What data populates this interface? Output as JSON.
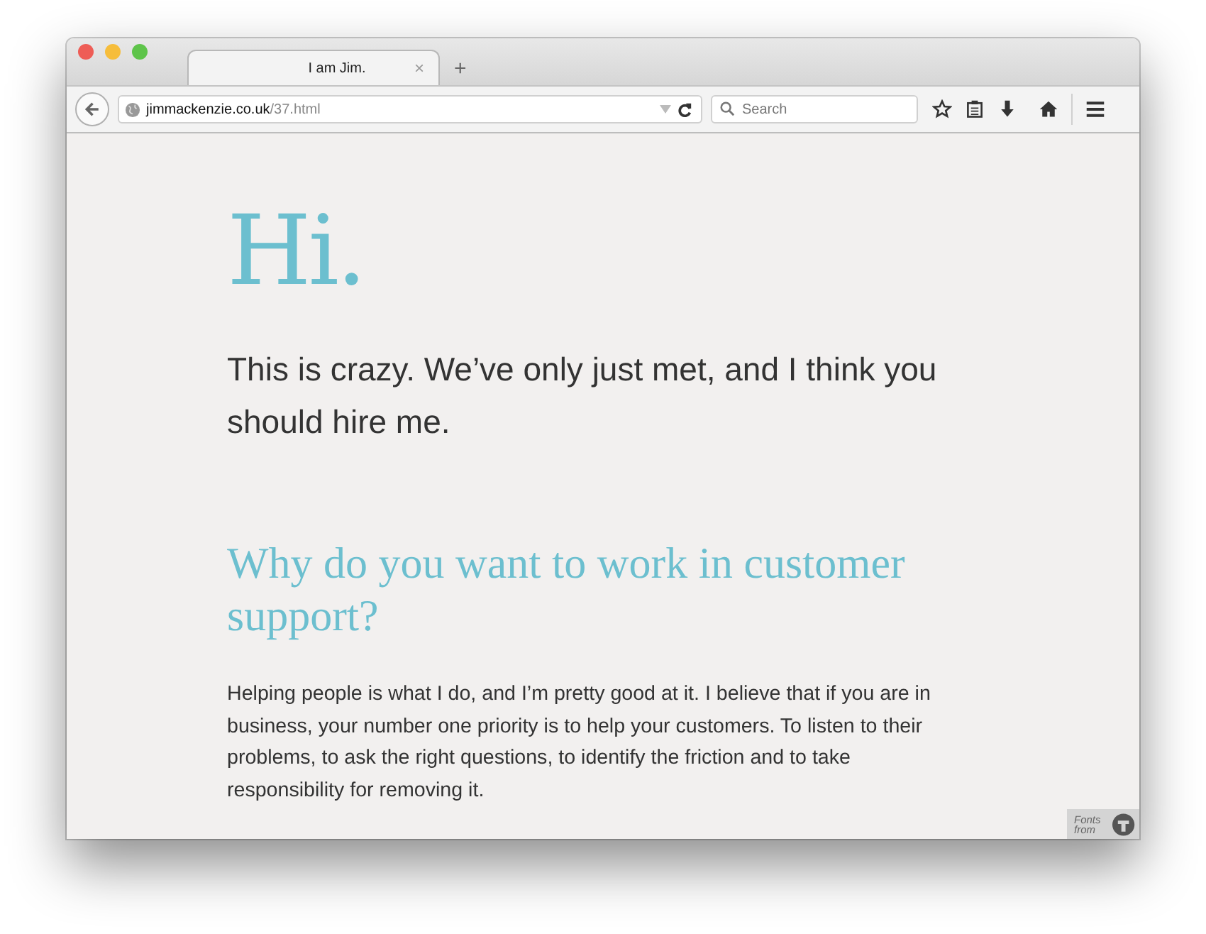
{
  "window": {
    "tab": {
      "title": "I am Jim.",
      "close": "×",
      "selected": true
    },
    "new_tab": "+"
  },
  "toolbar": {
    "url": {
      "domain": "jimmackenzie.co.uk",
      "path": "/37.html"
    },
    "search": {
      "placeholder": "Search"
    }
  },
  "page": {
    "greeting": "Hi.",
    "intro": "This is crazy. We’ve only just met, and I think you should hire me.",
    "sections": [
      {
        "question": "Why do you want to work in customer support?",
        "answer": "Helping people is what I do, and I’m pretty good at it. I believe that if you are in business, your number one priority is to help your customers. To listen to their problems, to ask the right questions, to identify the friction and to take responsibility for removing it."
      }
    ],
    "fonts_badge": "Fonts from"
  }
}
